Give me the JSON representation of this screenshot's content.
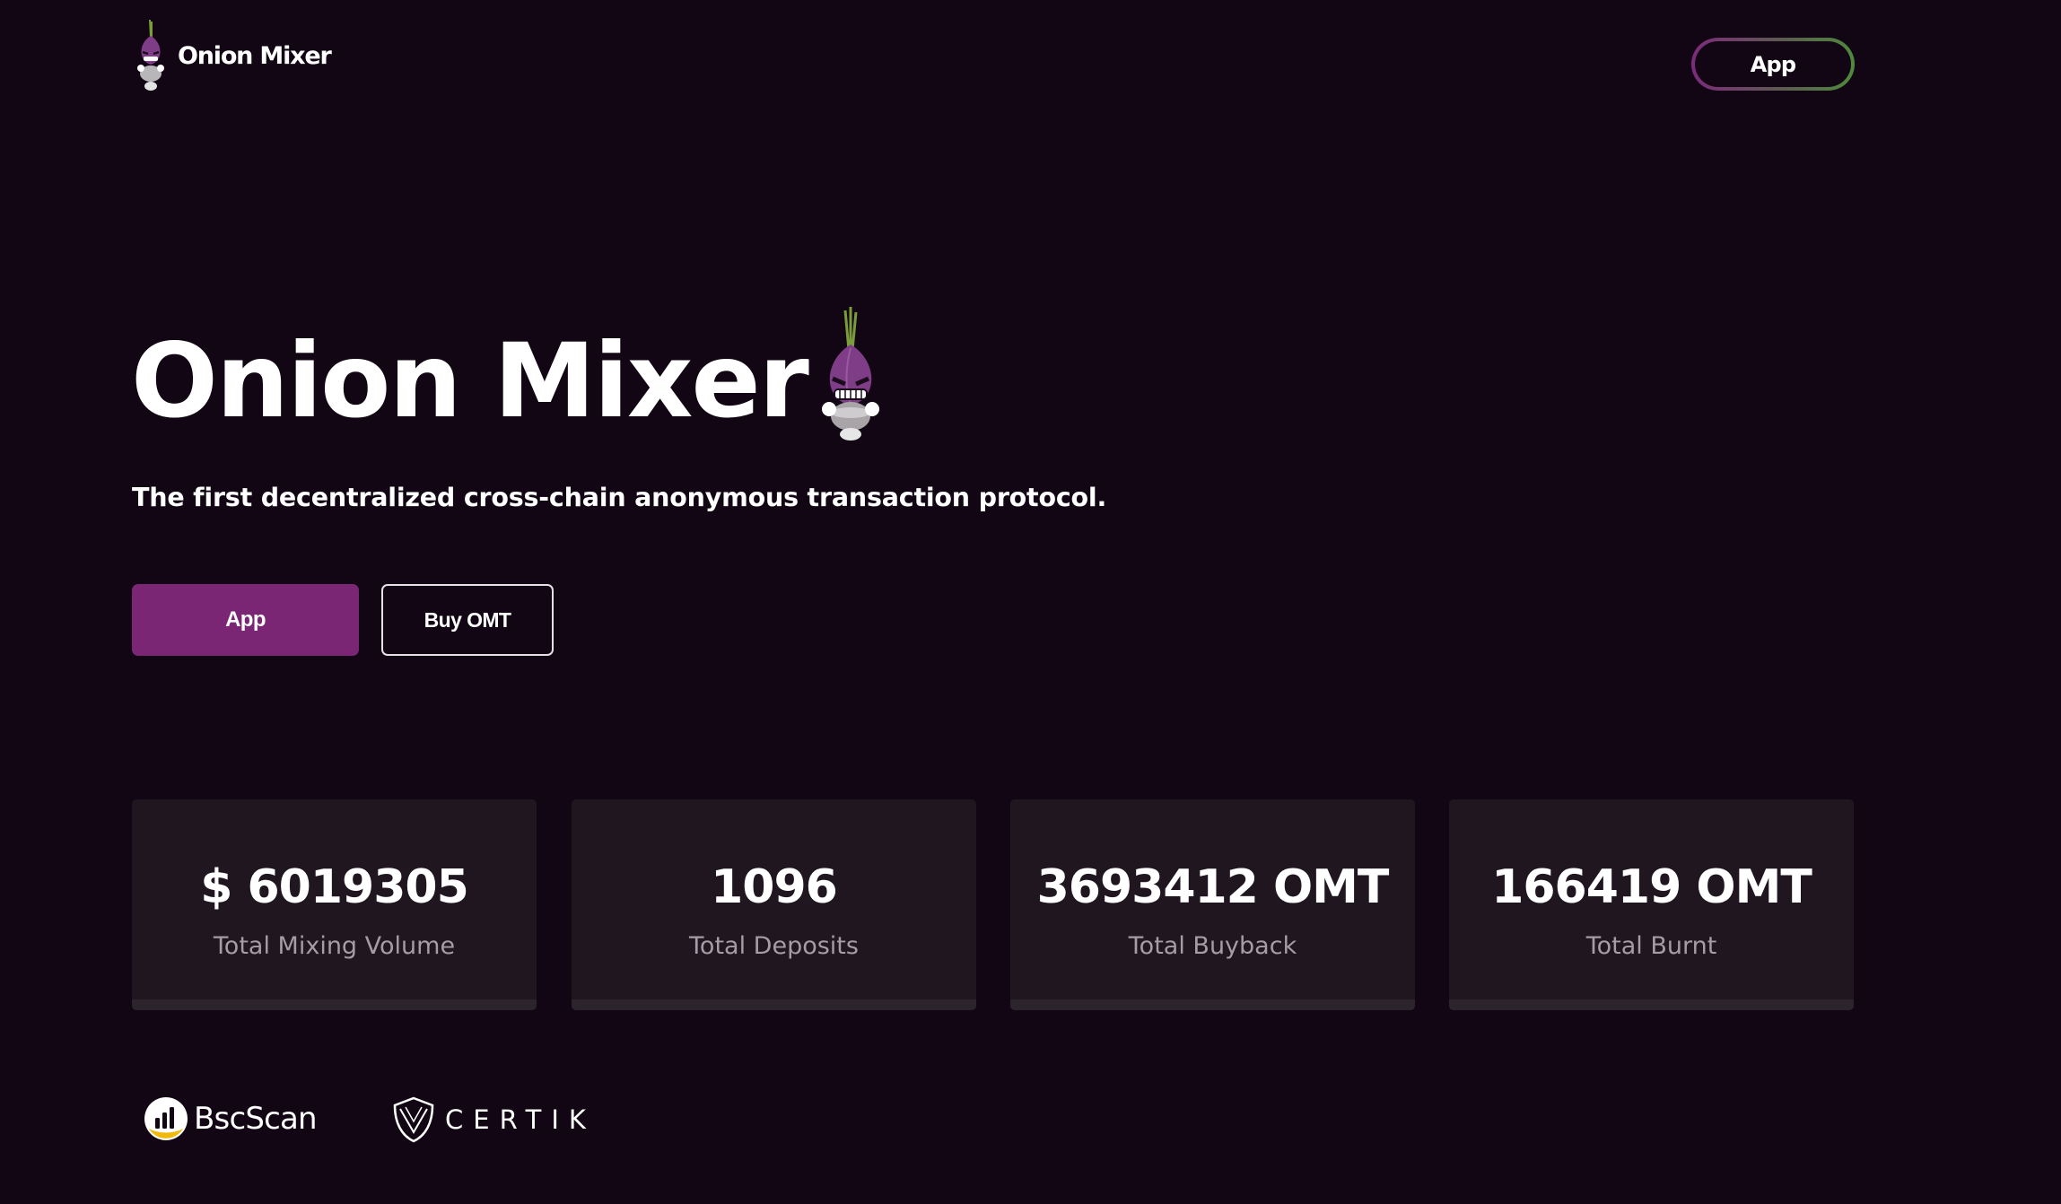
{
  "header": {
    "brand_name": "Onion Mixer",
    "brand_icon": "onion-mascot-icon",
    "app_button_label": "App"
  },
  "hero": {
    "title": "Onion Mixer",
    "mascot_icon": "onion-mascot-icon",
    "tagline": "The first decentralized cross-chain anonymous transaction protocol.",
    "primary_button_label": "App",
    "secondary_button_label": "Buy OMT"
  },
  "stats": [
    {
      "value": "$ 6019305",
      "label": "Total Mixing Volume"
    },
    {
      "value": "1096",
      "label": "Total Deposits"
    },
    {
      "value": "3693412 OMT",
      "label": "Total Buyback"
    },
    {
      "value": "166419 OMT",
      "label": "Total Burnt"
    }
  ],
  "partners": {
    "bscscan": {
      "name": "BscScan",
      "icon": "bscscan-logo-icon"
    },
    "certik": {
      "name": "CERTIK",
      "icon": "certik-shield-icon"
    }
  },
  "colors": {
    "background": "#120614",
    "accent_purple": "#7a2674",
    "card": "#1f1620",
    "muted_text": "#a59ca5",
    "gradient_start": "#7d2b7c",
    "gradient_end": "#4e8a3c"
  }
}
